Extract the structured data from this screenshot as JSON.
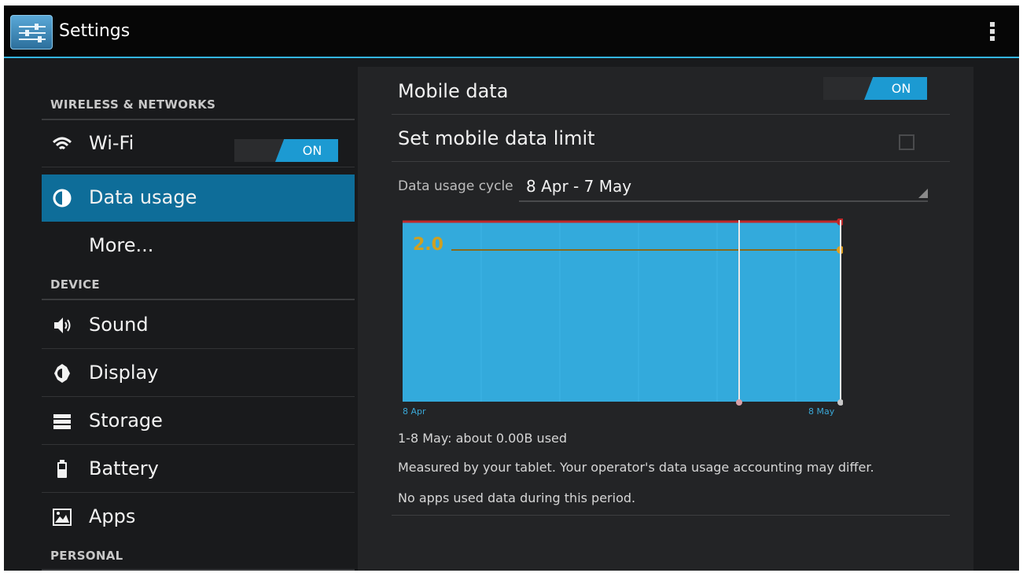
{
  "action_bar": {
    "title": "Settings",
    "app_icon": "settings-sliders-icon",
    "overflow_icon": "overflow-menu-icon"
  },
  "sidebar": {
    "sections": [
      {
        "header": "WIRELESS & NETWORKS",
        "items": [
          {
            "label": "Wi-Fi",
            "icon": "wifi-icon",
            "toggle": "ON"
          },
          {
            "label": "Data usage",
            "icon": "data-usage-icon",
            "selected": true
          },
          {
            "label": "More...",
            "icon": ""
          }
        ]
      },
      {
        "header": "DEVICE",
        "items": [
          {
            "label": "Sound",
            "icon": "speaker-icon"
          },
          {
            "label": "Display",
            "icon": "brightness-icon"
          },
          {
            "label": "Storage",
            "icon": "storage-icon"
          },
          {
            "label": "Battery",
            "icon": "battery-icon"
          },
          {
            "label": "Apps",
            "icon": "apps-icon"
          }
        ]
      },
      {
        "header": "PERSONAL",
        "items": []
      }
    ]
  },
  "detail": {
    "mobile_data": {
      "label": "Mobile data",
      "toggle": "ON"
    },
    "data_limit": {
      "label": "Set mobile data limit",
      "checked": false
    },
    "cycle": {
      "label": "Data usage cycle",
      "value": "8 Apr - 7 May"
    },
    "chart": {
      "warning_value": "2.0",
      "start_label": "8 Apr",
      "end_label": "8 May"
    },
    "usage_summary": "1-8 May: about 0.00B used",
    "disclaimer": "Measured by your tablet. Your operator's data usage accounting may differ.",
    "no_apps": "No apps used data during this period."
  },
  "colors": {
    "accent": "#33b5e5",
    "selected": "#0e6d99",
    "chart_fill": "#33aadc",
    "warning": "#d0a020",
    "limit": "#c0282a"
  }
}
